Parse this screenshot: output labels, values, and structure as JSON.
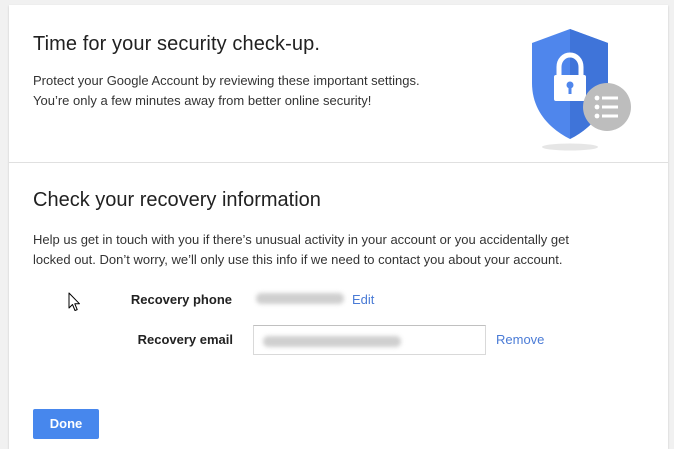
{
  "header": {
    "title": "Time for your security check-up.",
    "description_line1": "Protect your Google Account by reviewing these important settings.",
    "description_line2": "You’re only a few minutes away from better online security!"
  },
  "section": {
    "title": "Check your recovery information",
    "description_line1": "Help us get in touch with you if there’s unusual activity in your account or you accidentally get",
    "description_line2": "locked out. Don’t worry, we’ll only use this info if we need to contact you about your account."
  },
  "recovery_phone": {
    "label": "Recovery phone",
    "action": "Edit"
  },
  "recovery_email": {
    "label": "Recovery email",
    "action": "Remove"
  },
  "done_button": {
    "label": "Done"
  },
  "colors": {
    "accent": "#4787ed",
    "link": "#4a7bd6",
    "shield": "#4f86ec",
    "badge": "#bdbdbd"
  }
}
